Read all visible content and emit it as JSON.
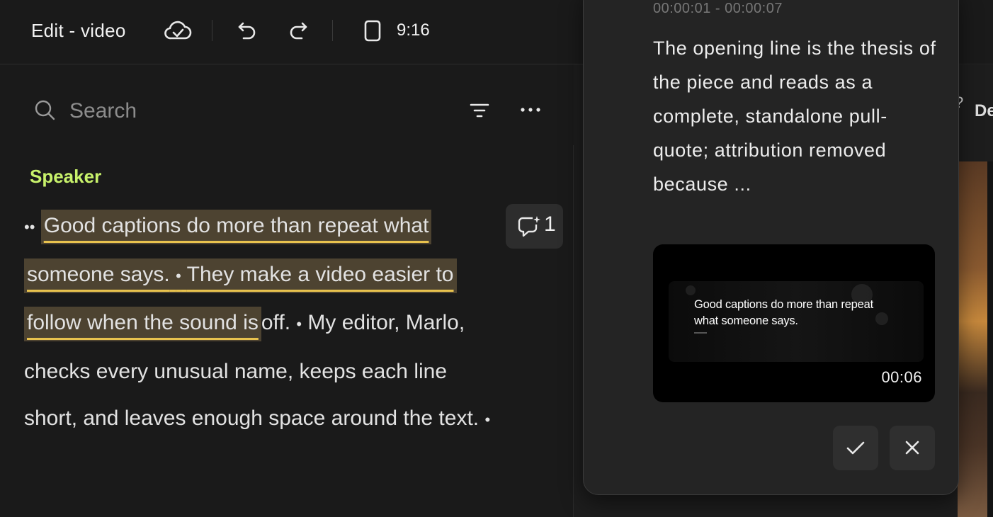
{
  "header": {
    "title": "Edit - video",
    "aspect_ratio": "9:16",
    "icons": [
      "cloud-check-icon",
      "undo-icon",
      "redo-icon",
      "phone-portrait-icon"
    ]
  },
  "search": {
    "placeholder": "Search"
  },
  "transcript": {
    "speaker": "Speaker",
    "highlighted_text_1": "Good captions do more than repeat what",
    "highlighted_text_2": "someone says.",
    "highlighted_text_3": "They make a video easier to follow when the sound is",
    "text_4": "off.",
    "text_5": "My editor, Marlo, checks every unusual name, keeps each line short, and leaves enough space around the text.",
    "comment_count": "1"
  },
  "popover": {
    "time_range": "00:00:01 - 00:00:07",
    "note": "The opening line is the thesis of the piece and reads as a complete, standalone pull-quote; attribution removed because ...",
    "preview_caption": "Good captions do more than repeat what someone says.",
    "preview_time": "00:06"
  },
  "right_panel": {
    "partial_label": "De",
    "partial_icon_text": "?"
  },
  "colors": {
    "background": "#1a1a1a",
    "speaker": "#c8f26b",
    "highlight": "#4d4331",
    "underline": "#e8c24e",
    "popover": "#242424"
  }
}
